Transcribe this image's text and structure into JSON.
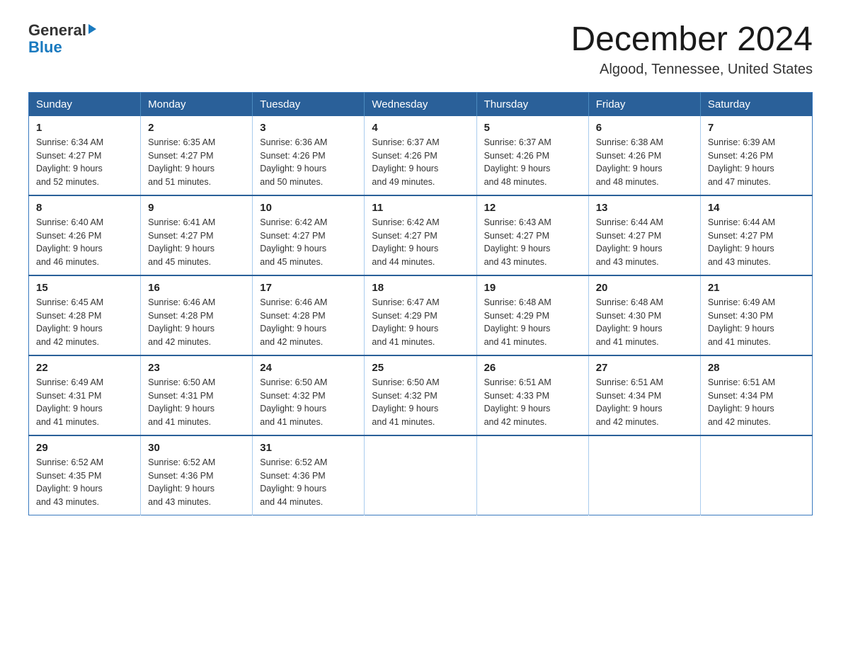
{
  "header": {
    "logo_general": "General",
    "logo_blue": "Blue",
    "month_title": "December 2024",
    "location": "Algood, Tennessee, United States"
  },
  "days_of_week": [
    "Sunday",
    "Monday",
    "Tuesday",
    "Wednesday",
    "Thursday",
    "Friday",
    "Saturday"
  ],
  "weeks": [
    [
      {
        "day": "1",
        "sunrise": "6:34 AM",
        "sunset": "4:27 PM",
        "daylight": "9 hours and 52 minutes."
      },
      {
        "day": "2",
        "sunrise": "6:35 AM",
        "sunset": "4:27 PM",
        "daylight": "9 hours and 51 minutes."
      },
      {
        "day": "3",
        "sunrise": "6:36 AM",
        "sunset": "4:26 PM",
        "daylight": "9 hours and 50 minutes."
      },
      {
        "day": "4",
        "sunrise": "6:37 AM",
        "sunset": "4:26 PM",
        "daylight": "9 hours and 49 minutes."
      },
      {
        "day": "5",
        "sunrise": "6:37 AM",
        "sunset": "4:26 PM",
        "daylight": "9 hours and 48 minutes."
      },
      {
        "day": "6",
        "sunrise": "6:38 AM",
        "sunset": "4:26 PM",
        "daylight": "9 hours and 48 minutes."
      },
      {
        "day": "7",
        "sunrise": "6:39 AM",
        "sunset": "4:26 PM",
        "daylight": "9 hours and 47 minutes."
      }
    ],
    [
      {
        "day": "8",
        "sunrise": "6:40 AM",
        "sunset": "4:26 PM",
        "daylight": "9 hours and 46 minutes."
      },
      {
        "day": "9",
        "sunrise": "6:41 AM",
        "sunset": "4:27 PM",
        "daylight": "9 hours and 45 minutes."
      },
      {
        "day": "10",
        "sunrise": "6:42 AM",
        "sunset": "4:27 PM",
        "daylight": "9 hours and 45 minutes."
      },
      {
        "day": "11",
        "sunrise": "6:42 AM",
        "sunset": "4:27 PM",
        "daylight": "9 hours and 44 minutes."
      },
      {
        "day": "12",
        "sunrise": "6:43 AM",
        "sunset": "4:27 PM",
        "daylight": "9 hours and 43 minutes."
      },
      {
        "day": "13",
        "sunrise": "6:44 AM",
        "sunset": "4:27 PM",
        "daylight": "9 hours and 43 minutes."
      },
      {
        "day": "14",
        "sunrise": "6:44 AM",
        "sunset": "4:27 PM",
        "daylight": "9 hours and 43 minutes."
      }
    ],
    [
      {
        "day": "15",
        "sunrise": "6:45 AM",
        "sunset": "4:28 PM",
        "daylight": "9 hours and 42 minutes."
      },
      {
        "day": "16",
        "sunrise": "6:46 AM",
        "sunset": "4:28 PM",
        "daylight": "9 hours and 42 minutes."
      },
      {
        "day": "17",
        "sunrise": "6:46 AM",
        "sunset": "4:28 PM",
        "daylight": "9 hours and 42 minutes."
      },
      {
        "day": "18",
        "sunrise": "6:47 AM",
        "sunset": "4:29 PM",
        "daylight": "9 hours and 41 minutes."
      },
      {
        "day": "19",
        "sunrise": "6:48 AM",
        "sunset": "4:29 PM",
        "daylight": "9 hours and 41 minutes."
      },
      {
        "day": "20",
        "sunrise": "6:48 AM",
        "sunset": "4:30 PM",
        "daylight": "9 hours and 41 minutes."
      },
      {
        "day": "21",
        "sunrise": "6:49 AM",
        "sunset": "4:30 PM",
        "daylight": "9 hours and 41 minutes."
      }
    ],
    [
      {
        "day": "22",
        "sunrise": "6:49 AM",
        "sunset": "4:31 PM",
        "daylight": "9 hours and 41 minutes."
      },
      {
        "day": "23",
        "sunrise": "6:50 AM",
        "sunset": "4:31 PM",
        "daylight": "9 hours and 41 minutes."
      },
      {
        "day": "24",
        "sunrise": "6:50 AM",
        "sunset": "4:32 PM",
        "daylight": "9 hours and 41 minutes."
      },
      {
        "day": "25",
        "sunrise": "6:50 AM",
        "sunset": "4:32 PM",
        "daylight": "9 hours and 41 minutes."
      },
      {
        "day": "26",
        "sunrise": "6:51 AM",
        "sunset": "4:33 PM",
        "daylight": "9 hours and 42 minutes."
      },
      {
        "day": "27",
        "sunrise": "6:51 AM",
        "sunset": "4:34 PM",
        "daylight": "9 hours and 42 minutes."
      },
      {
        "day": "28",
        "sunrise": "6:51 AM",
        "sunset": "4:34 PM",
        "daylight": "9 hours and 42 minutes."
      }
    ],
    [
      {
        "day": "29",
        "sunrise": "6:52 AM",
        "sunset": "4:35 PM",
        "daylight": "9 hours and 43 minutes."
      },
      {
        "day": "30",
        "sunrise": "6:52 AM",
        "sunset": "4:36 PM",
        "daylight": "9 hours and 43 minutes."
      },
      {
        "day": "31",
        "sunrise": "6:52 AM",
        "sunset": "4:36 PM",
        "daylight": "9 hours and 44 minutes."
      },
      null,
      null,
      null,
      null
    ]
  ],
  "labels": {
    "sunrise": "Sunrise:",
    "sunset": "Sunset:",
    "daylight": "Daylight:"
  }
}
